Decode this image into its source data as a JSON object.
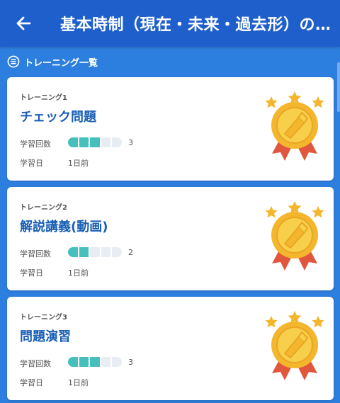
{
  "header": {
    "title": "基本時制（現在・未来・過去形）の…",
    "back_icon": "arrow-left-icon"
  },
  "list": {
    "title": "トレーニング一覧",
    "icon": "list-icon"
  },
  "labels": {
    "study_count": "学習回数",
    "study_day": "学習日"
  },
  "colors": {
    "background": "#2d7fdf",
    "topbar": "#1f5fcc",
    "card_title": "#1a5fb4",
    "progress_on": "#45c0bd",
    "progress_off": "#e7edf3"
  },
  "trainings": [
    {
      "number": "トレーニング1",
      "name": "チェック問題",
      "count": "3",
      "progress_segments": 5,
      "progress_filled": 3,
      "date": "1日前",
      "medal": "gold-medal-icon"
    },
    {
      "number": "トレーニング2",
      "name": "解説講義(動画)",
      "count": "2",
      "progress_segments": 5,
      "progress_filled": 2,
      "date": "1日前",
      "medal": "gold-medal-icon"
    },
    {
      "number": "トレーニング3",
      "name": "問題演習",
      "count": "3",
      "progress_segments": 5,
      "progress_filled": 3,
      "date": "1日前",
      "medal": "gold-medal-icon"
    }
  ]
}
